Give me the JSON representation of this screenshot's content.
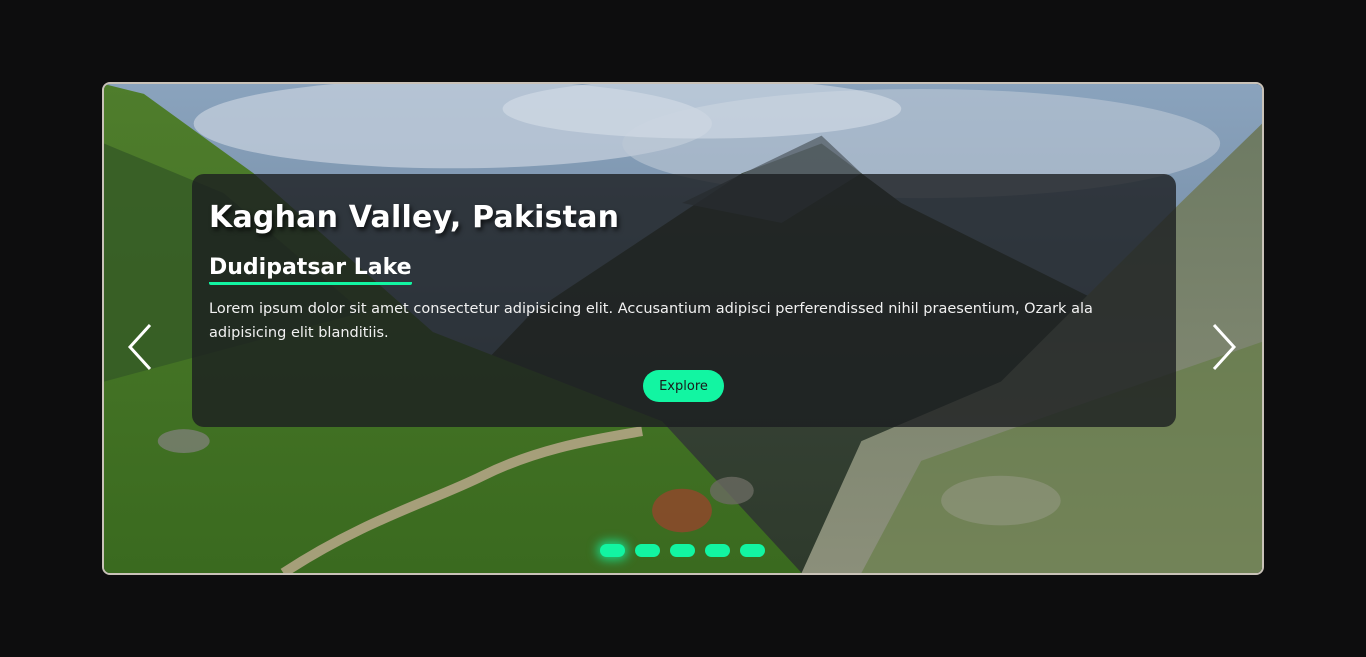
{
  "slide": {
    "title": "Kaghan Valley, Pakistan",
    "subtitle": "Dudipatsar Lake",
    "description": "Lorem ipsum dolor sit amet consectetur adipisicing elit. Accusantium adipisci perferendissed nihil praesentium, Ozark ala adipisicing elit blanditiis.",
    "button_label": "Explore"
  },
  "controls": {
    "prev_icon": "chevron-left-icon",
    "next_icon": "chevron-right-icon",
    "dot_count": 5,
    "active_dot": 1
  },
  "colors": {
    "accent": "#12f5a2",
    "page_background": "#0d0d0e",
    "card_background": "rgba(28,30,33,0.80)"
  }
}
